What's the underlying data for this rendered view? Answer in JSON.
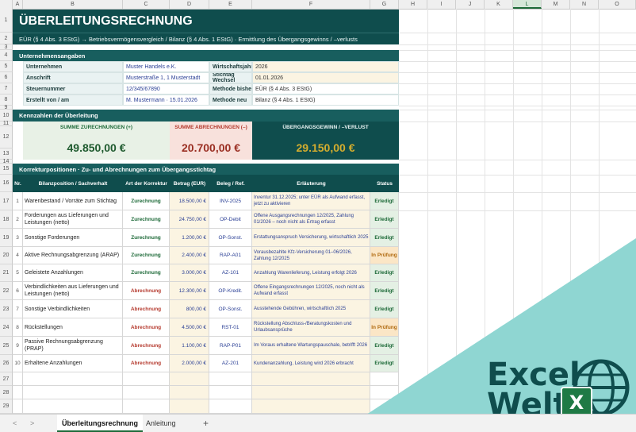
{
  "columns": [
    "A",
    "B",
    "C",
    "D",
    "E",
    "F",
    "G",
    "H",
    "I",
    "J",
    "K",
    "L",
    "M",
    "N",
    "O"
  ],
  "selected_column": "L",
  "title": "ÜBERLEITUNGSRECHNUNG",
  "subtitle": "EÜR (§ 4 Abs. 3 EStG)  →  Betriebsvermögensvergleich / Bilanz (§ 4 Abs. 1 EStG)   ·   Ermittlung des Übergangsgewinns / –verlusts",
  "sections": {
    "company": "Unternehmensangaben",
    "kpis": "Kennzahlen der Überleitung",
    "positions": "Korrekturpositionen  ·  Zu- und Abrechnungen zum Übergangsstichtag"
  },
  "company": {
    "labels": [
      "Unternehmen",
      "Anschrift",
      "Steuernummer",
      "Erstellt von / am"
    ],
    "values": [
      "Muster Handels e.K.",
      "Musterstraße 1, 1 Musterstadt",
      "12/345/67890",
      "M. Mustermann · 15.01.2026"
    ],
    "labels2": [
      "Wirtschaftsjahr",
      "Stichtag Wechsel",
      "Methode bisher",
      "Methode neu"
    ],
    "values2": [
      "2026",
      "01.01.2026",
      "EÜR (§ 4 Abs. 3 EStG)",
      "Bilanz (§ 4 Abs. 1 EStG)"
    ]
  },
  "kpis": {
    "zurechnungen_label": "SUMME ZURECHNUNGEN (+)",
    "zurechnungen_value": "49.850,00 €",
    "abrechnungen_label": "SUMME ABRECHNUNGEN (–)",
    "abrechnungen_value": "20.700,00 €",
    "uebergang_label": "ÜBERGANGSGEWINN / –VERLUST",
    "uebergang_value": "29.150,00 €"
  },
  "table": {
    "headers": [
      "Nr.",
      "Bilanzposition / Sachverhalt",
      "Art der Korrektur",
      "Betrag (EUR)",
      "Beleg / Ref.",
      "Erläuterung",
      "Status"
    ],
    "rows": [
      {
        "no": "1",
        "pos": "Warenbestand / Vorräte zum Stichtag",
        "art": "Zurechnung",
        "betrag": "18.500,00 €",
        "beleg": "INV-2025",
        "erl": "Inventur 31.12.2025; unter EÜR als Aufwand erfasst, jetzt zu aktivieren",
        "status": "Erledigt"
      },
      {
        "no": "2",
        "pos": "Forderungen aus Lieferungen und Leistungen (netto)",
        "art": "Zurechnung",
        "betrag": "24.750,00 €",
        "beleg": "OP-Debit",
        "erl": "Offene Ausgangsrechnungen 12/2025, Zahlung 01/2026 – noch nicht als Ertrag erfasst",
        "status": "Erledigt"
      },
      {
        "no": "3",
        "pos": "Sonstige Forderungen",
        "art": "Zurechnung",
        "betrag": "1.200,00 €",
        "beleg": "OP-Sonst.",
        "erl": "Erstattungsanspruch Versicherung, wirtschaftlich 2025",
        "status": "Erledigt"
      },
      {
        "no": "4",
        "pos": "Aktive Rechnungsabgrenzung (ARAP)",
        "art": "Zurechnung",
        "betrag": "2.400,00 €",
        "beleg": "RAP-A01",
        "erl": "Vorausbezahlte Kfz-Versicherung 01–06/2026, Zahlung 12/2025",
        "status": "In Prüfung"
      },
      {
        "no": "5",
        "pos": "Geleistete Anzahlungen",
        "art": "Zurechnung",
        "betrag": "3.000,00 €",
        "beleg": "AZ-101",
        "erl": "Anzahlung Warenlieferung, Leistung erfolgt 2026",
        "status": "Erledigt"
      },
      {
        "no": "6",
        "pos": "Verbindlichkeiten aus Lieferungen und Leistungen (netto)",
        "art": "Abrechnung",
        "betrag": "12.300,00 €",
        "beleg": "OP-Kredit.",
        "erl": "Offene Eingangsrechnungen 12/2025, noch nicht als Aufwand erfasst",
        "status": "Erledigt"
      },
      {
        "no": "7",
        "pos": "Sonstige Verbindlichkeiten",
        "art": "Abrechnung",
        "betrag": "800,00 €",
        "beleg": "OP-Sonst.",
        "erl": "Ausstehende Gebühren, wirtschaftlich 2025",
        "status": "Erledigt"
      },
      {
        "no": "8",
        "pos": "Rückstellungen",
        "art": "Abrechnung",
        "betrag": "4.500,00 €",
        "beleg": "RST-01",
        "erl": "Rückstellung Abschluss-/Beratungskosten und Urlaubsansprüche",
        "status": "In Prüfung"
      },
      {
        "no": "9",
        "pos": "Passive Rechnungsabgrenzung (PRAP)",
        "art": "Abrechnung",
        "betrag": "1.100,00 €",
        "beleg": "RAP-P01",
        "erl": "Im Voraus erhaltene Wartungspauschale, betrifft 2026",
        "status": "Erledigt"
      },
      {
        "no": "10",
        "pos": "Erhaltene Anzahlungen",
        "art": "Abrechnung",
        "betrag": "2.000,00 €",
        "beleg": "AZ-201",
        "erl": "Kundenanzahlung, Leistung wird 2026 erbracht",
        "status": "Erledigt"
      }
    ]
  },
  "rownums": {
    "top": [
      "1",
      "2",
      "3",
      "4",
      "5",
      "6",
      "7",
      "8",
      "9",
      "10",
      "11",
      "12",
      "13",
      "14",
      "15",
      "16"
    ],
    "data": [
      "17",
      "18",
      "19",
      "20",
      "21",
      "22",
      "23",
      "24",
      "25",
      "26"
    ],
    "empty": [
      "27",
      "28",
      "29"
    ]
  },
  "tabs": {
    "sheet1": "Überleitungsrechnung",
    "sheet2": "Anleitung",
    "add": "+",
    "prev": "<",
    "next": ">"
  },
  "logo": {
    "line1": "Excel",
    "line2": "Welt",
    "badge": "X"
  },
  "colors": {
    "teal_dark": "#0f4d4d",
    "teal": "#185e5e",
    "green": "#1e6a39",
    "red": "#b53a2e",
    "gold": "#c9a227"
  }
}
